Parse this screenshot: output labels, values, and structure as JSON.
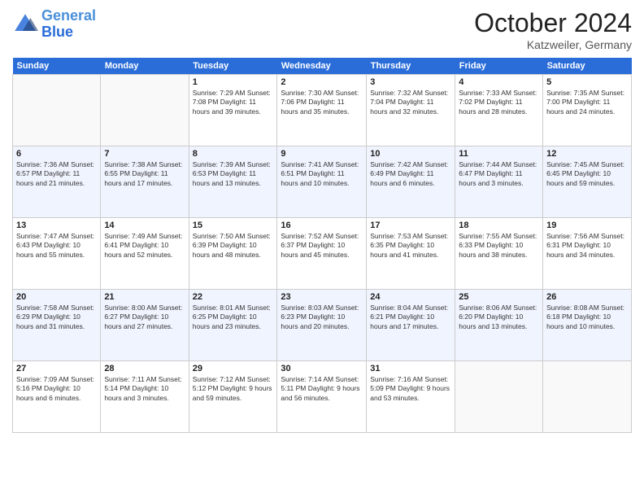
{
  "header": {
    "logo_line1": "General",
    "logo_line2": "Blue",
    "month": "October 2024",
    "location": "Katzweiler, Germany"
  },
  "weekdays": [
    "Sunday",
    "Monday",
    "Tuesday",
    "Wednesday",
    "Thursday",
    "Friday",
    "Saturday"
  ],
  "weeks": [
    [
      {
        "day": "",
        "info": ""
      },
      {
        "day": "",
        "info": ""
      },
      {
        "day": "1",
        "info": "Sunrise: 7:29 AM\nSunset: 7:08 PM\nDaylight: 11 hours and 39 minutes."
      },
      {
        "day": "2",
        "info": "Sunrise: 7:30 AM\nSunset: 7:06 PM\nDaylight: 11 hours and 35 minutes."
      },
      {
        "day": "3",
        "info": "Sunrise: 7:32 AM\nSunset: 7:04 PM\nDaylight: 11 hours and 32 minutes."
      },
      {
        "day": "4",
        "info": "Sunrise: 7:33 AM\nSunset: 7:02 PM\nDaylight: 11 hours and 28 minutes."
      },
      {
        "day": "5",
        "info": "Sunrise: 7:35 AM\nSunset: 7:00 PM\nDaylight: 11 hours and 24 minutes."
      }
    ],
    [
      {
        "day": "6",
        "info": "Sunrise: 7:36 AM\nSunset: 6:57 PM\nDaylight: 11 hours and 21 minutes."
      },
      {
        "day": "7",
        "info": "Sunrise: 7:38 AM\nSunset: 6:55 PM\nDaylight: 11 hours and 17 minutes."
      },
      {
        "day": "8",
        "info": "Sunrise: 7:39 AM\nSunset: 6:53 PM\nDaylight: 11 hours and 13 minutes."
      },
      {
        "day": "9",
        "info": "Sunrise: 7:41 AM\nSunset: 6:51 PM\nDaylight: 11 hours and 10 minutes."
      },
      {
        "day": "10",
        "info": "Sunrise: 7:42 AM\nSunset: 6:49 PM\nDaylight: 11 hours and 6 minutes."
      },
      {
        "day": "11",
        "info": "Sunrise: 7:44 AM\nSunset: 6:47 PM\nDaylight: 11 hours and 3 minutes."
      },
      {
        "day": "12",
        "info": "Sunrise: 7:45 AM\nSunset: 6:45 PM\nDaylight: 10 hours and 59 minutes."
      }
    ],
    [
      {
        "day": "13",
        "info": "Sunrise: 7:47 AM\nSunset: 6:43 PM\nDaylight: 10 hours and 55 minutes."
      },
      {
        "day": "14",
        "info": "Sunrise: 7:49 AM\nSunset: 6:41 PM\nDaylight: 10 hours and 52 minutes."
      },
      {
        "day": "15",
        "info": "Sunrise: 7:50 AM\nSunset: 6:39 PM\nDaylight: 10 hours and 48 minutes."
      },
      {
        "day": "16",
        "info": "Sunrise: 7:52 AM\nSunset: 6:37 PM\nDaylight: 10 hours and 45 minutes."
      },
      {
        "day": "17",
        "info": "Sunrise: 7:53 AM\nSunset: 6:35 PM\nDaylight: 10 hours and 41 minutes."
      },
      {
        "day": "18",
        "info": "Sunrise: 7:55 AM\nSunset: 6:33 PM\nDaylight: 10 hours and 38 minutes."
      },
      {
        "day": "19",
        "info": "Sunrise: 7:56 AM\nSunset: 6:31 PM\nDaylight: 10 hours and 34 minutes."
      }
    ],
    [
      {
        "day": "20",
        "info": "Sunrise: 7:58 AM\nSunset: 6:29 PM\nDaylight: 10 hours and 31 minutes."
      },
      {
        "day": "21",
        "info": "Sunrise: 8:00 AM\nSunset: 6:27 PM\nDaylight: 10 hours and 27 minutes."
      },
      {
        "day": "22",
        "info": "Sunrise: 8:01 AM\nSunset: 6:25 PM\nDaylight: 10 hours and 23 minutes."
      },
      {
        "day": "23",
        "info": "Sunrise: 8:03 AM\nSunset: 6:23 PM\nDaylight: 10 hours and 20 minutes."
      },
      {
        "day": "24",
        "info": "Sunrise: 8:04 AM\nSunset: 6:21 PM\nDaylight: 10 hours and 17 minutes."
      },
      {
        "day": "25",
        "info": "Sunrise: 8:06 AM\nSunset: 6:20 PM\nDaylight: 10 hours and 13 minutes."
      },
      {
        "day": "26",
        "info": "Sunrise: 8:08 AM\nSunset: 6:18 PM\nDaylight: 10 hours and 10 minutes."
      }
    ],
    [
      {
        "day": "27",
        "info": "Sunrise: 7:09 AM\nSunset: 5:16 PM\nDaylight: 10 hours and 6 minutes."
      },
      {
        "day": "28",
        "info": "Sunrise: 7:11 AM\nSunset: 5:14 PM\nDaylight: 10 hours and 3 minutes."
      },
      {
        "day": "29",
        "info": "Sunrise: 7:12 AM\nSunset: 5:12 PM\nDaylight: 9 hours and 59 minutes."
      },
      {
        "day": "30",
        "info": "Sunrise: 7:14 AM\nSunset: 5:11 PM\nDaylight: 9 hours and 56 minutes."
      },
      {
        "day": "31",
        "info": "Sunrise: 7:16 AM\nSunset: 5:09 PM\nDaylight: 9 hours and 53 minutes."
      },
      {
        "day": "",
        "info": ""
      },
      {
        "day": "",
        "info": ""
      }
    ]
  ]
}
